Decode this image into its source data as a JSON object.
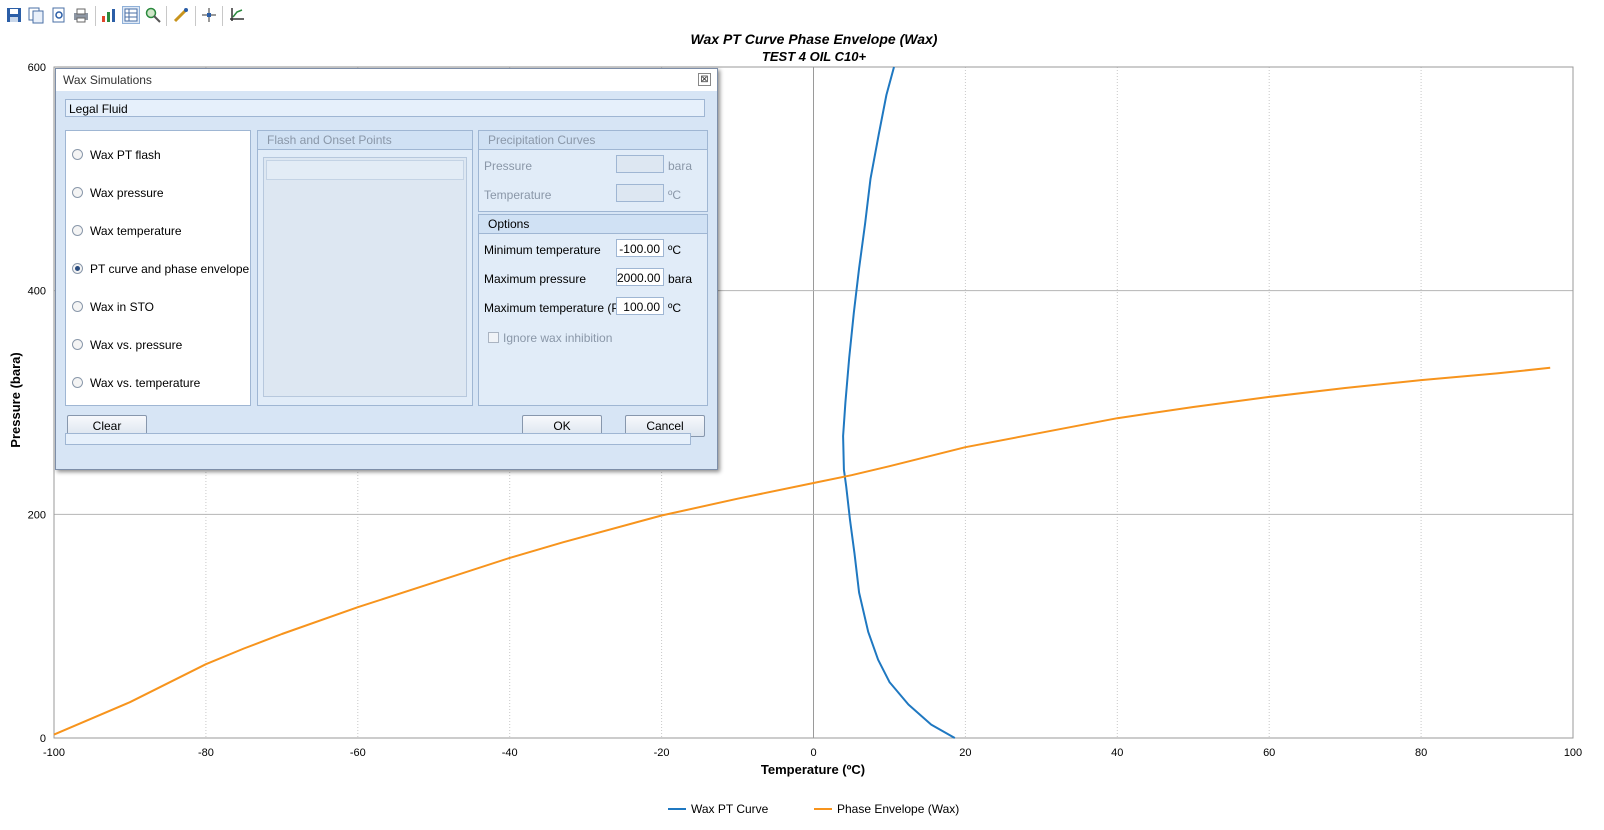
{
  "window": {
    "dialog_title": "Wax Simulations",
    "fluid_name": "Legal Fluid",
    "close_glyph": "⊠"
  },
  "toolbar": {
    "icons": [
      "save-icon",
      "copy-icon",
      "print-preview-icon",
      "print-icon",
      "chart-icon",
      "table-icon",
      "zoom-icon",
      "edit-icon",
      "crosshair-icon",
      "axis-icon"
    ]
  },
  "dialog": {
    "options": [
      {
        "label": "Wax PT flash",
        "selected": false
      },
      {
        "label": "Wax pressure",
        "selected": false
      },
      {
        "label": "Wax temperature",
        "selected": false
      },
      {
        "label": "PT curve and phase envelope",
        "selected": true
      },
      {
        "label": "Wax in STO",
        "selected": false
      },
      {
        "label": "Wax vs. pressure",
        "selected": false
      },
      {
        "label": "Wax vs. temperature",
        "selected": false
      }
    ],
    "flash_panel_title": "Flash and Onset Points",
    "precipitation": {
      "title": "Precipitation Curves",
      "pressure_label": "Pressure",
      "pressure_unit": "bara",
      "temperature_label": "Temperature",
      "temperature_unit": "ºC"
    },
    "options_group": {
      "title": "Options",
      "min_temp_label": "Minimum temperature",
      "min_temp_value": "-100.00",
      "min_temp_unit": "ºC",
      "max_pressure_label": "Maximum pressure",
      "max_pressure_value": "2000.00",
      "max_pressure_unit": "bara",
      "max_temp_label": "Maximum temperature (PE)",
      "max_temp_value": "100.00",
      "max_temp_unit": "ºC",
      "ignore_label": "Ignore wax inhibition"
    },
    "buttons": {
      "clear": "Clear",
      "ok": "OK",
      "cancel": "Cancel"
    }
  },
  "colors": {
    "series1": "#1f78c1",
    "series2": "#f7941d",
    "grid": "#c8c8c8"
  },
  "chart_data": {
    "type": "line",
    "title": "Wax PT Curve Phase Envelope (Wax)",
    "subtitle": "TEST 4 OIL C10+",
    "xlabel": "Temperature (ºC)",
    "ylabel": "Pressure (bara)",
    "xlim": [
      -100,
      100
    ],
    "ylim": [
      0,
      600
    ],
    "xticks": [
      -100,
      -80,
      -60,
      -40,
      -20,
      0,
      20,
      40,
      60,
      80,
      100
    ],
    "yticks": [
      0,
      200,
      400,
      600
    ],
    "grid": true,
    "legend_position": "bottom-center",
    "series": [
      {
        "name": "Wax PT Curve",
        "color": "#1f78c1",
        "x": [
          18.6,
          15.5,
          12.5,
          10.0,
          8.5,
          7.2,
          6.0,
          5.4,
          4.8,
          4.3,
          4.0,
          3.9,
          4.2,
          4.7,
          5.3,
          6.0,
          6.8,
          7.5,
          8.6,
          9.6,
          10.6
        ],
        "y": [
          0,
          12,
          30,
          50,
          70,
          95,
          130,
          165,
          195,
          225,
          240,
          270,
          300,
          340,
          380,
          420,
          460,
          500,
          540,
          575,
          600
        ]
      },
      {
        "name": "Phase Envelope (Wax)",
        "color": "#f7941d",
        "x": [
          -100,
          -90,
          -80,
          -75,
          -70,
          -60,
          -50,
          -40,
          -33,
          -20,
          -10,
          0,
          5,
          10,
          20,
          30,
          40,
          50,
          60,
          70,
          80,
          90,
          97
        ],
        "y": [
          3,
          32,
          66,
          80,
          93,
          117,
          139,
          161,
          175,
          199,
          214,
          228,
          235,
          243,
          260,
          273,
          286,
          296,
          305,
          313,
          320,
          326,
          331
        ]
      }
    ]
  }
}
